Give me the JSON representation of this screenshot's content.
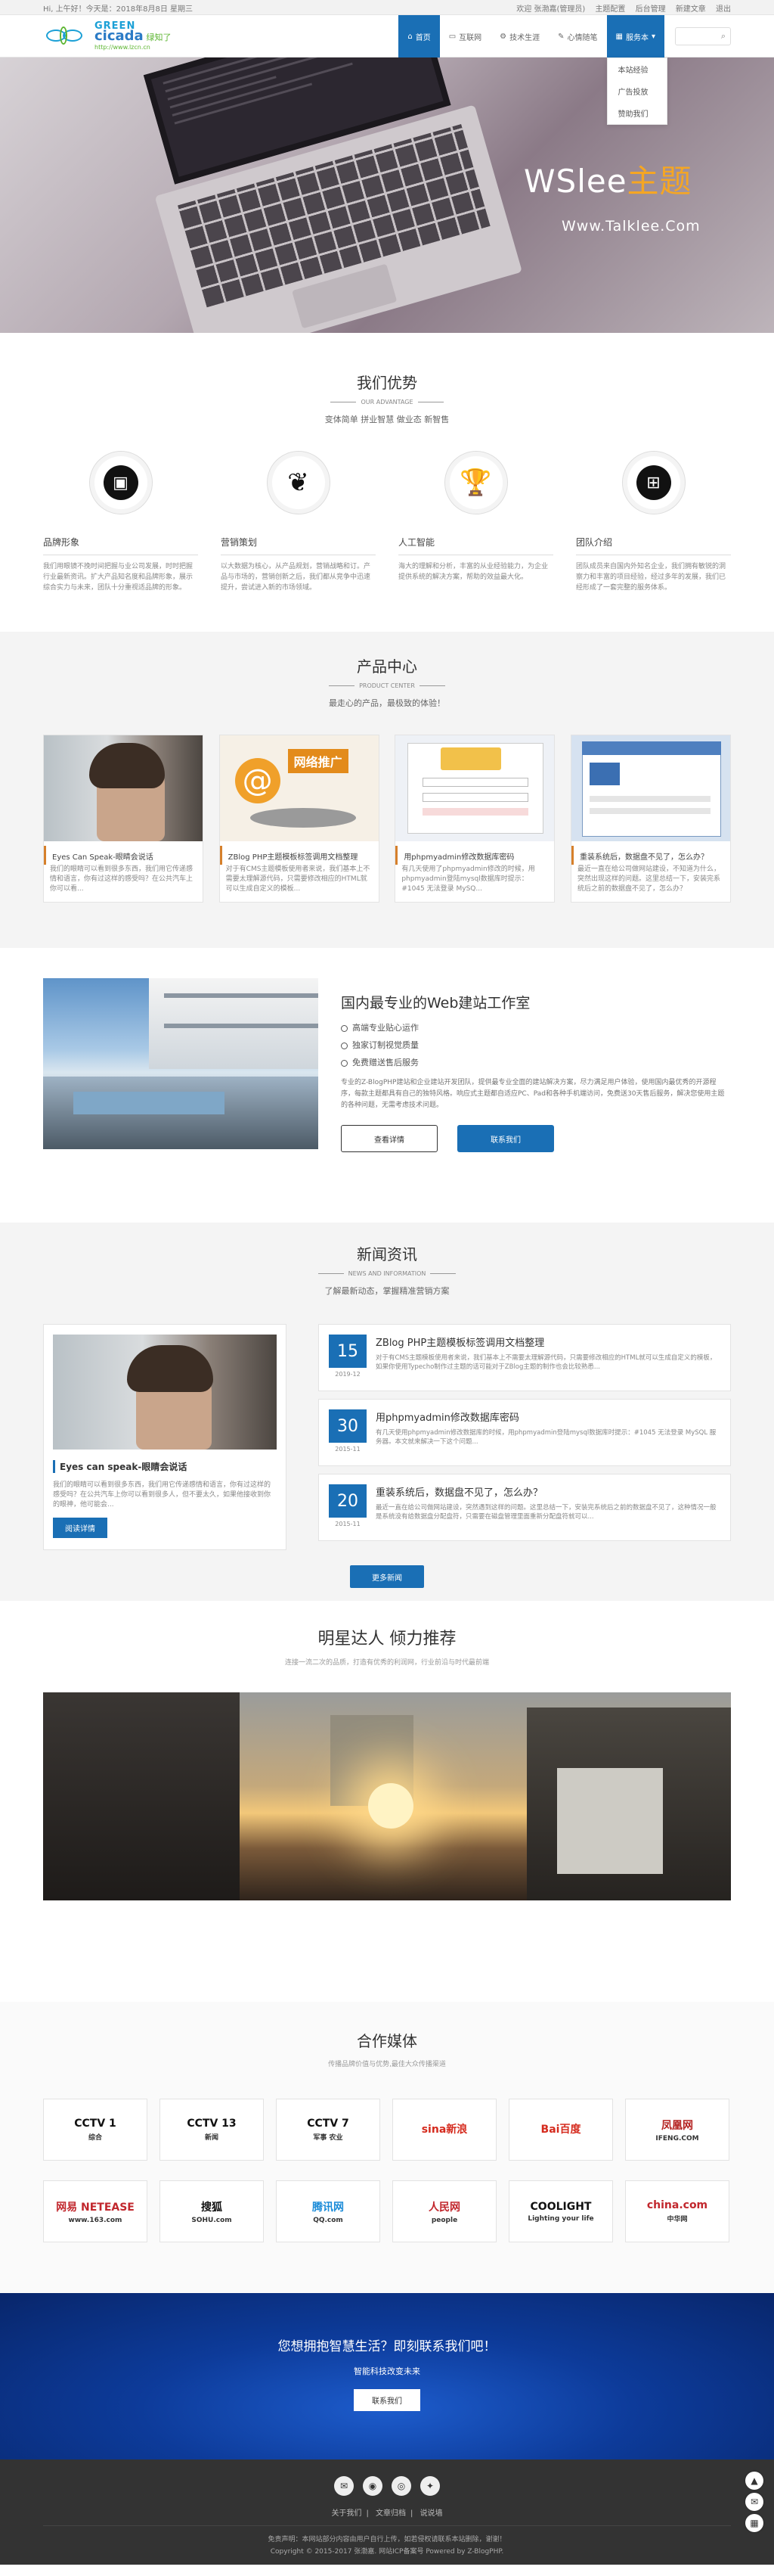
{
  "topbar": {
    "greeting": "Hi, 上午好！今天是：2018年8月8日 星期三",
    "links": [
      "欢迎 张渤嘉(管理员)",
      "主题配置",
      "后台管理",
      "新建文章",
      "退出"
    ]
  },
  "header": {
    "logo": {
      "green": "GREEN",
      "cicada": "cicada",
      "cn": "绿知了",
      "url": "http://www.lzcn.cn"
    },
    "nav": [
      "首页",
      "互联网",
      "技术生涯",
      "心情随笔",
      "服务本"
    ],
    "dropdown": [
      "本站经验",
      "广告投放",
      "赞助我们"
    ],
    "search_placeholder": ""
  },
  "banner": {
    "title_main": "WSlee",
    "title_accent": "主题",
    "subtitle": "Www.Talklee.Com"
  },
  "advantages": {
    "title": "我们优势",
    "en": "OUR ADVANTAGE",
    "desc": "变体简单 拼业智慧 做业态 新智售",
    "items": [
      {
        "title": "品牌形象",
        "text": "我们用眼镜不挽时间把握与业公司发展，时时把握行业最新资讯。扩大产品知名度和品牌形象，展示综合实力与未来，团队十分重视适品牌的形象。",
        "icon": "brand-icon"
      },
      {
        "title": "营销策划",
        "text": "以大数据为核心，从产品规划，营销战略和订。产品与市场的，营销创新之后，我们都从竞争中迅速提升，尝试进入新的市场领域。",
        "icon": "leaf-icon"
      },
      {
        "title": "人工智能",
        "text": "海大的理解和分析，丰富的从业经验能力，为企业提供系统的解决方案，帮助的效益最大化。",
        "icon": "trophy-icon"
      },
      {
        "title": "团队介绍",
        "text": "团队成员来自国内外知名企业，我们拥有敏锐的洞察力和丰富的项目经验，经过多年的发展，我们已经形成了一套完整的服务体系。",
        "icon": "gift-icon"
      }
    ]
  },
  "products": {
    "title": "产品中心",
    "en": "PRODUCT CENTER",
    "desc": "最走心的产品，最极致的体验！",
    "items": [
      {
        "title": "Eyes Can Speak-眼睛会说话",
        "text": "我们的眼睛可以看到很多东西，我们用它传递感情和语言，你有过这样的感受吗？在公共汽车上你可以看..."
      },
      {
        "title": "ZBlog PHP主题模板标签调用文档整理",
        "text": "对于有CMS主题模板使用者来说，我们基本上不需要太理解源代码，只需要修改相应的HTML就可以生成自定义的模板..."
      },
      {
        "title": "用phpmyadmin修改数据库密码",
        "text": "有几天使用了phpmyadmin修改的时候，用phpmyadmin登陆mysql数据库时提示：#1045 无法登录 MySQ..."
      },
      {
        "title": "重装系统后，数据盘不见了，怎么办？",
        "text": "最近一直在给公司做网站建设，不知道为什么，突然出现这样的问题。这里总结一下，安装完系统后之前的数据盘不见了，怎么办？"
      }
    ]
  },
  "studio": {
    "title": "国内最专业的Web建站工作室",
    "points": [
      "高端专业贴心运作",
      "独家订制视觉质量",
      "免费赠送售后服务"
    ],
    "text": "专业的Z-BlogPHP建站和企业建站开发团队，提供最专业全面的建站解决方案，尽力满足用户体验，使用国内最优秀的开源程序，每款主题都具有自己的独特风格。响应式主题都自适应PC、Pad和各种手机端访问，免费送30天售后服务，解决您使用主题的各种问题，无需考虑技术问题。",
    "btn_detail": "查看详情",
    "btn_contact": "联系我们"
  },
  "news": {
    "title": "新闻资讯",
    "en": "NEWS AND INFORMATION",
    "desc": "了解最新动态，掌握精准营销方案",
    "main": {
      "title": "Eyes can speak-眼睛会说话",
      "text": "我们的眼睛可以看到很多东西，我们用它传递感情和语言，你有过这样的感受吗？在公共汽车上你可以看到很多人，但不要太久，如果他接收到你的眼神，他可能会...",
      "btn": "阅读详情"
    },
    "items": [
      {
        "day": "15",
        "ym": "2019-12",
        "title": "ZBlog PHP主题模板标签调用文档整理",
        "text": "对于有CMS主题模板使用者来说，我们基本上不需要太理解源代码，只需要修改相应的HTML就可以生成自定义的模板，如果你使用Typecho制作过主题的话可能对于ZBlog主题的制作也会比较熟悉..."
      },
      {
        "day": "30",
        "ym": "2015-11",
        "title": "用phpmyadmin修改数据库密码",
        "text": "有几天使用phpmyadmin修改数据库的时候，用phpmyadmin登陆mysql数据库时提示：#1045 无法登录 MySQL 服务器。本文就来解决一下这个问题..."
      },
      {
        "day": "20",
        "ym": "2015-11",
        "title": "重装系统后，数据盘不见了，怎么办？",
        "text": "最近一直在给公司做网站建设，突然遇到这样的问题。这里总结一下，安装完系统后之前的数据盘不见了，这种情况一般是系统没有给数据盘分配盘符，只需要在磁盘管理里面重新分配盘符就可以..."
      }
    ],
    "more": "更多新闻"
  },
  "star": {
    "title": "明星达人 倾力推荐",
    "desc": "连接一流二次的品质，打造有优秀的利润网，行业前沿与时代最前端"
  },
  "media": {
    "title": "合作媒体",
    "desc": "传播品牌价值与优势,最佳大众传播渠道",
    "logos": [
      {
        "main": "CCTV 1",
        "sub": "综合",
        "color": "#111"
      },
      {
        "main": "CCTV 13",
        "sub": "新闻",
        "color": "#111"
      },
      {
        "main": "CCTV 7",
        "sub": "军事 农业",
        "color": "#111"
      },
      {
        "main": "sina新浪",
        "sub": "",
        "color": "#d52b1e"
      },
      {
        "main": "Bai百度",
        "sub": "",
        "color": "#d52b1e"
      },
      {
        "main": "凤凰网",
        "sub": "IFENG.COM",
        "color": "#b3201f"
      },
      {
        "main": "网易 NETEASE",
        "sub": "www.163.com",
        "color": "#c1272d"
      },
      {
        "main": "搜狐",
        "sub": "SOHU.com",
        "color": "#111"
      },
      {
        "main": "腾讯网",
        "sub": "QQ.com",
        "color": "#1a8bd8"
      },
      {
        "main": "人民网",
        "sub": "people",
        "color": "#c1272d"
      },
      {
        "main": "COOLIGHT",
        "sub": "Lighting your life",
        "color": "#111"
      },
      {
        "main": "china.com",
        "sub": "中华网",
        "color": "#c1272d"
      }
    ]
  },
  "contact": {
    "title": "您想拥抱智慧生活？即刻联系我们吧！",
    "sub": "智能科技改变未来",
    "btn": "联系我们"
  },
  "footer": {
    "links": [
      "关于我们",
      "文章归档",
      "说说墙"
    ],
    "notice": "免责声明：本网站部分内容由用户自行上传，如若侵权请联系本站删除，谢谢！",
    "copyright": "Copyright © 2015-2017 张渤嘉. 网站ICP备案号 Powered by Z-BlogPHP."
  }
}
